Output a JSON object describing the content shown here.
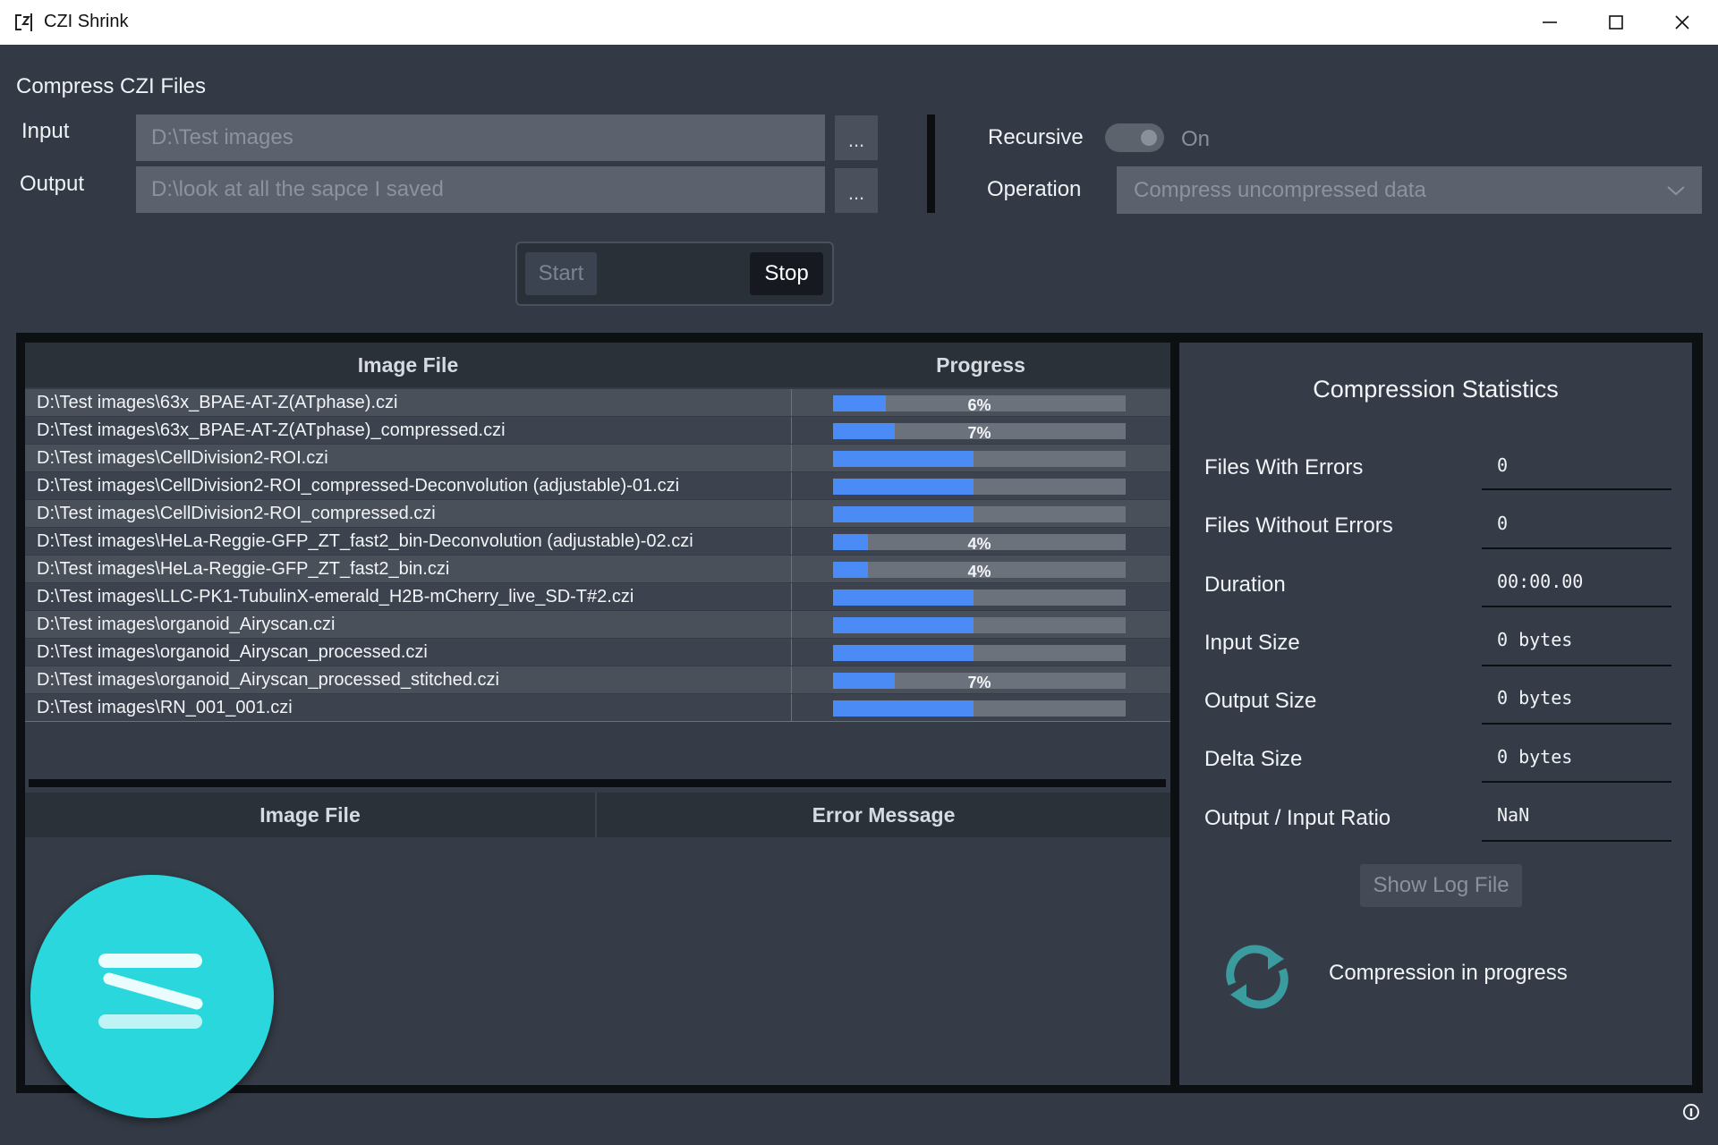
{
  "window": {
    "title": "CZI Shrink"
  },
  "header": {
    "section_title": "Compress CZI Files",
    "input_label": "Input",
    "input_value": "D:\\Test images",
    "output_label": "Output",
    "output_value": "D:\\look at all the sapce I saved",
    "browse_label": "...",
    "recursive_label": "Recursive",
    "recursive_state": "On",
    "operation_label": "Operation",
    "operation_value": "Compress uncompressed data"
  },
  "actions": {
    "start_label": "Start",
    "stop_label": "Stop"
  },
  "files_table": {
    "col_file": "Image File",
    "col_progress": "Progress",
    "rows": [
      {
        "file": "D:\\Test images\\63x_BPAE-AT-Z(ATphase).czi",
        "progress": 0.06,
        "label": "6%"
      },
      {
        "file": "D:\\Test images\\63x_BPAE-AT-Z(ATphase)_compressed.czi",
        "progress": 0.07,
        "label": "7%"
      },
      {
        "file": "D:\\Test images\\CellDivision2-ROI.czi",
        "progress": 0.48,
        "label": ""
      },
      {
        "file": "D:\\Test images\\CellDivision2-ROI_compressed-Deconvolution (adjustable)-01.czi",
        "progress": 0.48,
        "label": ""
      },
      {
        "file": "D:\\Test images\\CellDivision2-ROI_compressed.czi",
        "progress": 0.48,
        "label": ""
      },
      {
        "file": "D:\\Test images\\HeLa-Reggie-GFP_ZT_fast2_bin-Deconvolution (adjustable)-02.czi",
        "progress": 0.04,
        "label": "4%"
      },
      {
        "file": "D:\\Test images\\HeLa-Reggie-GFP_ZT_fast2_bin.czi",
        "progress": 0.04,
        "label": "4%"
      },
      {
        "file": "D:\\Test images\\LLC-PK1-TubulinX-emerald_H2B-mCherry_live_SD-T#2.czi",
        "progress": 0.48,
        "label": ""
      },
      {
        "file": "D:\\Test images\\organoid_Airyscan.czi",
        "progress": 0.48,
        "label": ""
      },
      {
        "file": "D:\\Test images\\organoid_Airyscan_processed.czi",
        "progress": 0.48,
        "label": ""
      },
      {
        "file": "D:\\Test images\\organoid_Airyscan_processed_stitched.czi",
        "progress": 0.07,
        "label": "7%"
      },
      {
        "file": "D:\\Test images\\RN_001_001.czi",
        "progress": 0.48,
        "label": ""
      }
    ]
  },
  "errors_table": {
    "col_file": "Image File",
    "col_error": "Error Message"
  },
  "stats": {
    "title": "Compression Statistics",
    "items": [
      {
        "label": "Files With Errors",
        "value": "0"
      },
      {
        "label": "Files Without Errors",
        "value": "0"
      },
      {
        "label": "Duration",
        "value": "00:00.00"
      },
      {
        "label": "Input Size",
        "value": "0 bytes"
      },
      {
        "label": "Output Size",
        "value": "0 bytes"
      },
      {
        "label": "Delta Size",
        "value": "0 bytes"
      },
      {
        "label": "Output / Input Ratio",
        "value": "NaN"
      }
    ],
    "log_button": "Show Log File",
    "status_text": "Compression in progress"
  },
  "colors": {
    "accent": "#4a8bf5",
    "logo": "#2ad7dd",
    "sync_icon": "#3a9c9e",
    "background": "#333a45"
  },
  "icons": [
    "app-icon",
    "minimize-icon",
    "maximize-icon",
    "close-icon",
    "chevron-down-icon",
    "sync-icon",
    "app-logo-icon",
    "info-icon"
  ]
}
